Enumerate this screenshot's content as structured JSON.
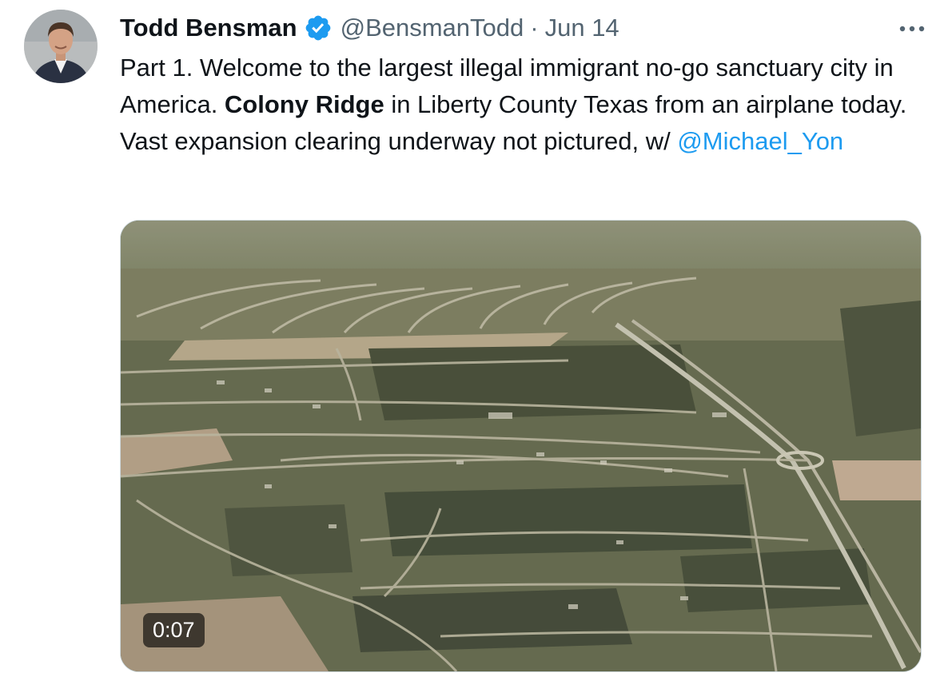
{
  "tweet": {
    "author_name": "Todd Bensman",
    "handle": "@BensmanTodd",
    "separator": "·",
    "date": "Jun 14",
    "text": {
      "part1": "Part 1. Welcome to the largest illegal immigrant no-go sanctuary city in America. ",
      "bold": "Colony Ridge",
      "part2": " in Liberty County Texas from an airplane today. Vast expansion clearing underway not pictured, w/ ",
      "mention": "@Michael_Yon"
    },
    "media": {
      "type": "video",
      "duration": "0:07"
    }
  },
  "icons": {
    "verified": "verified-badge-icon",
    "more": "more-options-icon"
  },
  "colors": {
    "text": "#0f1419",
    "secondary_text": "#536471",
    "link": "#1d9bf0",
    "verified": "#1d9bf0",
    "border": "#cfd9de"
  }
}
